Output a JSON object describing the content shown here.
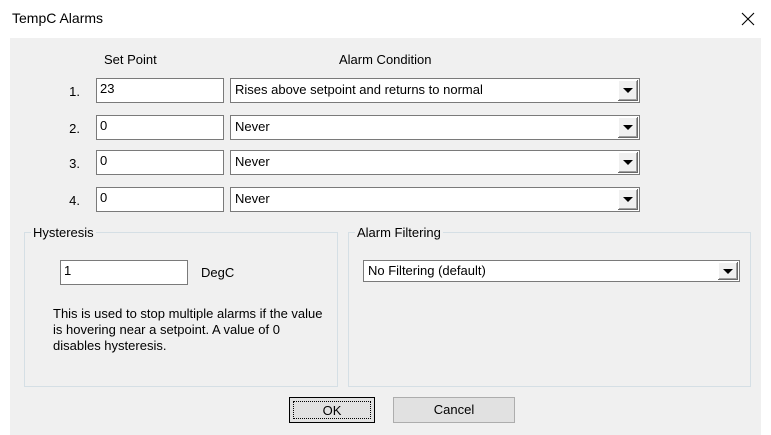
{
  "window": {
    "title": "TempC Alarms"
  },
  "headers": {
    "set_point": "Set Point",
    "alarm_condition": "Alarm Condition"
  },
  "alarms": [
    {
      "index": "1.",
      "setpoint": "23",
      "condition": "Rises above setpoint and returns to normal"
    },
    {
      "index": "2.",
      "setpoint": "0",
      "condition": "Never"
    },
    {
      "index": "3.",
      "setpoint": "0",
      "condition": "Never"
    },
    {
      "index": "4.",
      "setpoint": "0",
      "condition": "Never"
    }
  ],
  "hysteresis": {
    "label": "Hysteresis",
    "value": "1",
    "unit": "DegC",
    "help": "This is used to stop multiple alarms if the value is hovering near a setpoint.  A value of 0 disables hysteresis."
  },
  "filtering": {
    "label": "Alarm Filtering",
    "selected": "No Filtering (default)"
  },
  "buttons": {
    "ok": "OK",
    "cancel": "Cancel"
  }
}
